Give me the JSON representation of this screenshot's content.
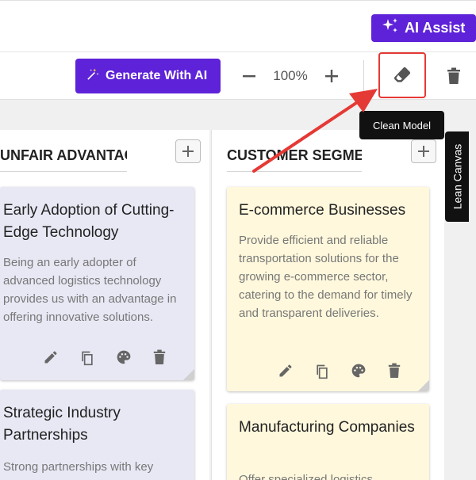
{
  "header": {
    "ai_assist_label": "AI Assist"
  },
  "toolbar": {
    "generate_label": "Generate With AI",
    "zoom_level": "100%"
  },
  "tooltip": {
    "text": "Clean Model"
  },
  "side_tab": {
    "label": "Lean Canvas"
  },
  "columns": [
    {
      "title": "UNFAIR ADVANTAGE",
      "cards": [
        {
          "title": "Early Adoption of Cutting-Edge Technology",
          "description": "Being an early adopter of advanced logistics technology provides us with an advantage in offering innovative solutions."
        },
        {
          "title": "Strategic Industry Partnerships",
          "description": "Strong partnerships with key"
        }
      ]
    },
    {
      "title": "CUSTOMER SEGMENTS",
      "cards": [
        {
          "title": "E-commerce Businesses",
          "description": "Provide efficient and reliable transportation solutions for the growing e-commerce sector, catering to the demand for timely and transparent deliveries."
        },
        {
          "title": "Manufacturing Companies",
          "description": "Offer specialized logistics"
        }
      ]
    }
  ],
  "colors": {
    "brand": "#5e22d8",
    "card_purple": "#e8e8f5",
    "card_yellow": "#fff8dc",
    "highlight": "#e53935"
  },
  "icons": [
    "sparkles-icon",
    "magic-wand-icon",
    "minus-icon",
    "plus-icon",
    "eraser-icon",
    "trash-icon",
    "pencil-icon",
    "copy-icon",
    "palette-icon"
  ]
}
